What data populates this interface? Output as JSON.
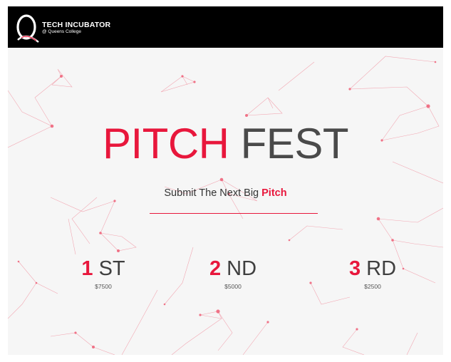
{
  "header": {
    "logo_letter": "Q",
    "logo_title": "TECH INCUBATOR",
    "logo_subtitle": "@ Queens College"
  },
  "hero": {
    "title_part1": "PITCH",
    "title_part2": "FEST",
    "subtitle_prefix": "Submit The Next Big ",
    "subtitle_highlight": "Pitch"
  },
  "prizes": [
    {
      "number": "1",
      "suffix": "ST",
      "amount": "$7500"
    },
    {
      "number": "2",
      "suffix": "ND",
      "amount": "$5000"
    },
    {
      "number": "3",
      "suffix": "RD",
      "amount": "$2500"
    }
  ],
  "colors": {
    "accent": "#e8173c",
    "header_bg": "#000000",
    "title_dark": "#4a4a4a",
    "background": "#f6f6f6"
  }
}
